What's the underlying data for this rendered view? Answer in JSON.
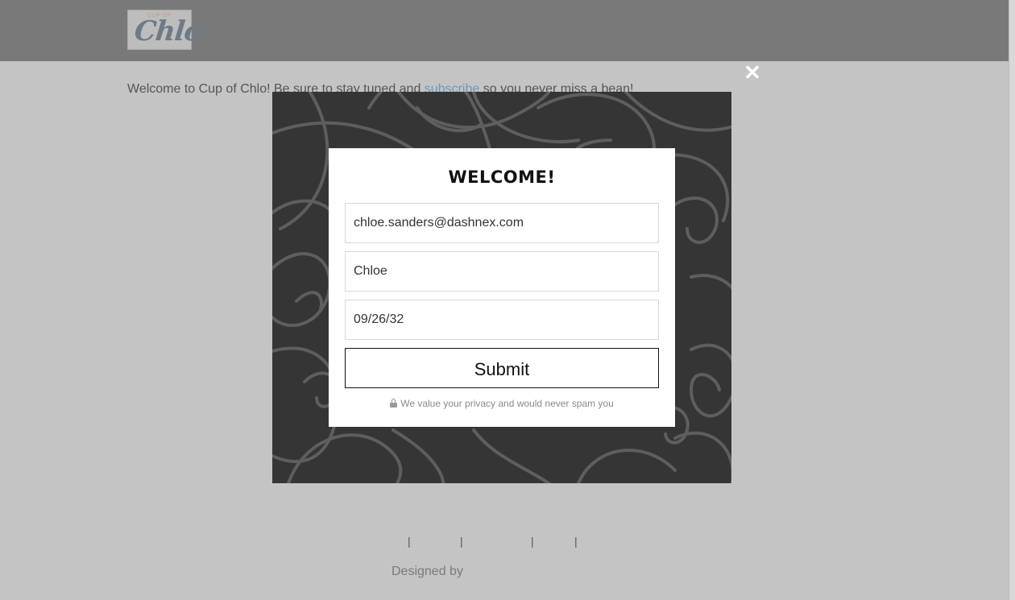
{
  "header": {
    "logo_small_text": "CUP OF",
    "logo_main_text": "Chlo"
  },
  "main": {
    "welcome_prefix": "Welcome to Cup of Chlo! Be sure to stay tuned and ",
    "welcome_link": "subscribe",
    "welcome_suffix": " so you never miss a bean!"
  },
  "footer": {
    "separator": "|",
    "designed_by": "Designed by"
  },
  "modal": {
    "close_label": "✕",
    "title": "WELCOME!",
    "email_value": "chloe.sanders@dashnex.com",
    "name_value": "Chloe",
    "date_value": "09/26/32",
    "submit_label": "Submit",
    "privacy_text": "We value your privacy and would never spam you"
  },
  "colors": {
    "modal_background": "#353535",
    "page_background": "#c4c4c4",
    "header_background": "#797979",
    "link": "#6f98bd"
  }
}
